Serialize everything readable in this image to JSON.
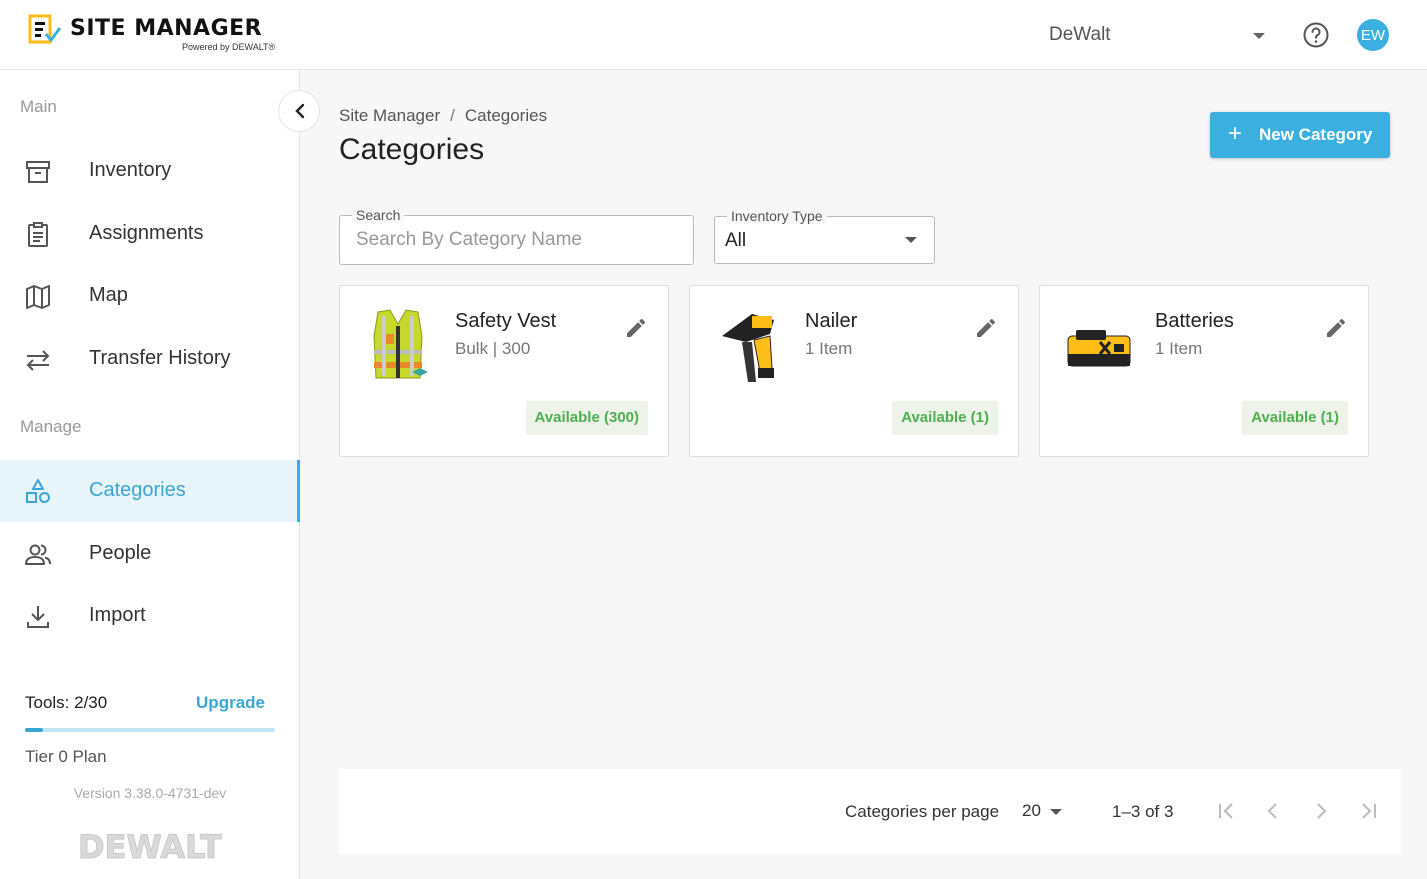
{
  "header": {
    "app_title": "SITE MANAGER",
    "app_subtitle": "Powered by DEWALT®",
    "org_name": "DeWalt",
    "avatar_initials": "EW"
  },
  "sidebar": {
    "main_label": "Main",
    "manage_label": "Manage",
    "main_items": [
      {
        "label": "Inventory",
        "icon": "archive-box-icon"
      },
      {
        "label": "Assignments",
        "icon": "clipboard-icon"
      },
      {
        "label": "Map",
        "icon": "map-icon"
      },
      {
        "label": "Transfer History",
        "icon": "transfer-arrows-icon"
      }
    ],
    "manage_items": [
      {
        "label": "Categories",
        "icon": "shapes-icon",
        "active": true
      },
      {
        "label": "People",
        "icon": "people-icon"
      },
      {
        "label": "Import",
        "icon": "download-icon"
      }
    ],
    "tools_label": "Tools: 2/30",
    "tools_used": 2,
    "tools_total": 30,
    "upgrade_label": "Upgrade",
    "plan_label": "Tier 0 Plan",
    "version_label": "Version 3.38.0-4731-dev",
    "brand_footer": "DEWALT"
  },
  "main": {
    "breadcrumb": [
      "Site Manager",
      "Categories"
    ],
    "page_title": "Categories",
    "new_button_label": "New Category",
    "search": {
      "legend": "Search",
      "placeholder": "Search By Category Name",
      "value": ""
    },
    "inventory_type": {
      "legend": "Inventory Type",
      "value": "All"
    },
    "cards": [
      {
        "name": "Safety Vest",
        "subtitle": "Bulk | 300",
        "badge": "Available (300)",
        "image": "safety-vest-image"
      },
      {
        "name": "Nailer",
        "subtitle": "1 Item",
        "badge": "Available (1)",
        "image": "nailer-image"
      },
      {
        "name": "Batteries",
        "subtitle": "1 Item",
        "badge": "Available (1)",
        "image": "battery-image"
      }
    ],
    "pagination": {
      "per_page_label": "Categories per page",
      "per_page_value": "20",
      "range_label": "1–3 of 3"
    }
  },
  "colors": {
    "accent": "#3bb0e0",
    "accent_text": "#3ba6d6",
    "available_green": "#4caf50",
    "brand_yellow": "#febd17"
  }
}
